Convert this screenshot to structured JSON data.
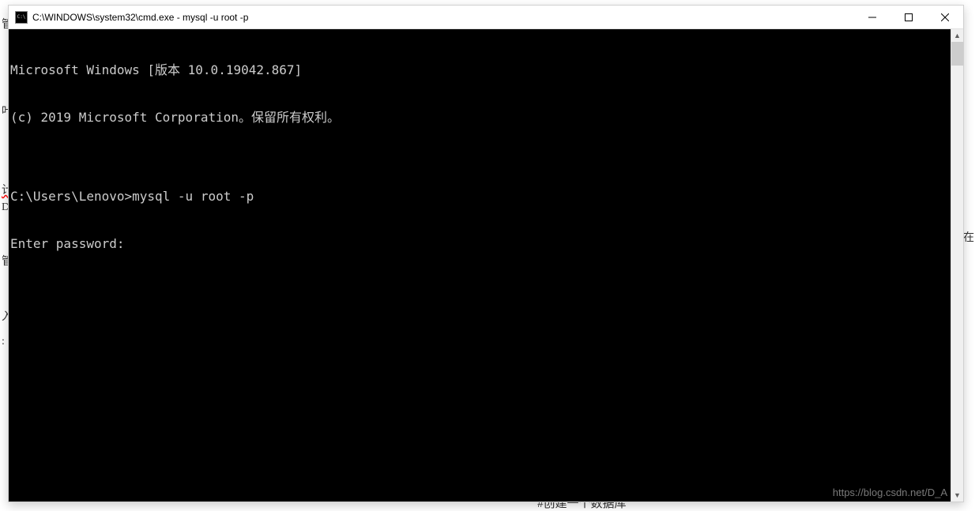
{
  "window": {
    "title": "C:\\WINDOWS\\system32\\cmd.exe - mysql  -u root -p"
  },
  "terminal": {
    "lines": [
      "Microsoft Windows [版本 10.0.19042.867]",
      "(c) 2019 Microsoft Corporation。保留所有权利。",
      "",
      "C:\\Users\\Lenovo>mysql -u root -p",
      "Enter password:"
    ]
  },
  "background": {
    "left_fragments": [
      "管",
      "叶",
      "计",
      "D",
      "管",
      "入",
      ":"
    ],
    "right_fragments": [
      "在"
    ],
    "bottom_text": "#创建一个数据库"
  },
  "watermark": {
    "text": "https://blog.csdn.net/D_A"
  }
}
